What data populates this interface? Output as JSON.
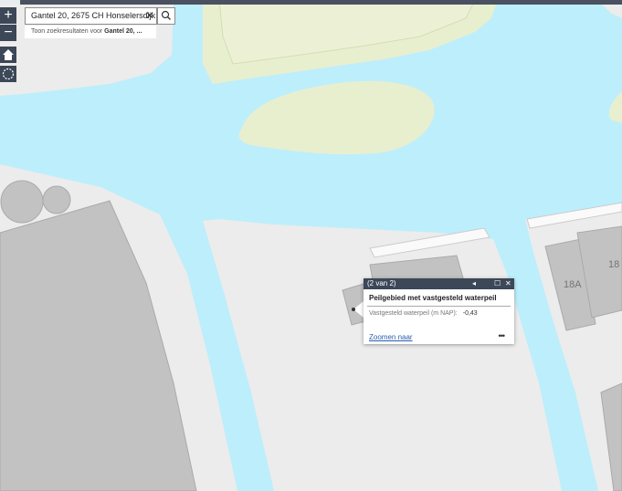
{
  "search": {
    "value": "Gantel 20, 2675 CH Honselersdijk",
    "suggestion_prefix": "Toon zoekresultaten voor",
    "suggestion_term": "Gantel 20, ..."
  },
  "controls": {
    "zoom_in": "+",
    "zoom_out": "−",
    "clear": "✕"
  },
  "map_labels": {
    "building_18a": "18A",
    "building_18": "18"
  },
  "popup": {
    "counter": "(2 van 2)",
    "prev": "◂",
    "maximize": "☐",
    "close": "✕",
    "title": "Peilgebied met vastgesteld waterpeil",
    "field_label": "Vastgesteld waterpeil (m NAP):",
    "field_value": "-0,43",
    "zoom_link": "Zoomen naar",
    "more": "•••"
  },
  "colors": {
    "water": "#bdeefc",
    "land": "#ececec",
    "building": "#c2c2c2",
    "green": "#e8efcf",
    "toolbar": "#3c4757"
  }
}
